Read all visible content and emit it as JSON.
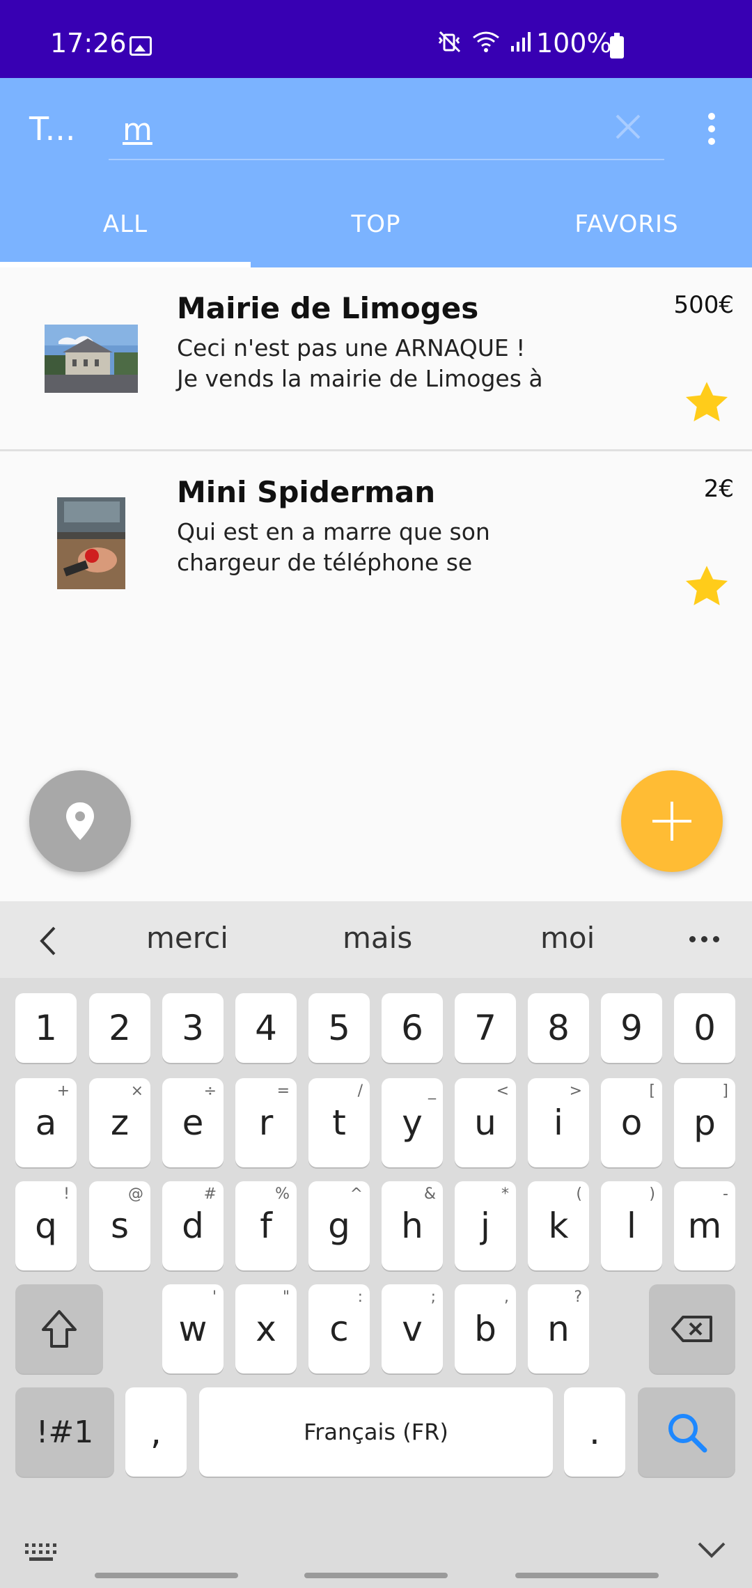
{
  "status_bar": {
    "time": "17:26",
    "battery": "100%"
  },
  "app_bar": {
    "title": "T...",
    "search_value": "m",
    "search_placeholder": ""
  },
  "tabs": [
    {
      "label": "ALL",
      "active": true
    },
    {
      "label": "TOP",
      "active": false
    },
    {
      "label": "FAVORIS",
      "active": false
    }
  ],
  "listings": [
    {
      "title": "Mairie de Limoges",
      "description_line1": "Ceci n'est pas une ARNAQUE !",
      "description_line2": "Je vends la mairie de Limoges à",
      "price": "500€",
      "favorite": true
    },
    {
      "title": "Mini Spiderman",
      "description_line1": "Qui est en a marre que son",
      "description_line2": "chargeur de téléphone se",
      "price": "2€",
      "favorite": true
    }
  ],
  "keyboard": {
    "suggestions": [
      "merci",
      "mais",
      "moi"
    ],
    "row_numbers": [
      "1",
      "2",
      "3",
      "4",
      "5",
      "6",
      "7",
      "8",
      "9",
      "0"
    ],
    "row1": [
      {
        "k": "a",
        "h": "+"
      },
      {
        "k": "z",
        "h": "×"
      },
      {
        "k": "e",
        "h": "÷"
      },
      {
        "k": "r",
        "h": "="
      },
      {
        "k": "t",
        "h": "/"
      },
      {
        "k": "y",
        "h": "_"
      },
      {
        "k": "u",
        "h": "<"
      },
      {
        "k": "i",
        "h": ">"
      },
      {
        "k": "o",
        "h": "["
      },
      {
        "k": "p",
        "h": "]"
      }
    ],
    "row2": [
      {
        "k": "q",
        "h": "!"
      },
      {
        "k": "s",
        "h": "@"
      },
      {
        "k": "d",
        "h": "#"
      },
      {
        "k": "f",
        "h": "%"
      },
      {
        "k": "g",
        "h": "^"
      },
      {
        "k": "h",
        "h": "&"
      },
      {
        "k": "j",
        "h": "*"
      },
      {
        "k": "k",
        "h": "("
      },
      {
        "k": "l",
        "h": ")"
      },
      {
        "k": "m",
        "h": "-"
      }
    ],
    "row3": [
      {
        "k": "w",
        "h": "'"
      },
      {
        "k": "x",
        "h": "\""
      },
      {
        "k": "c",
        "h": ":"
      },
      {
        "k": "v",
        "h": ";"
      },
      {
        "k": "b",
        "h": ","
      },
      {
        "k": "n",
        "h": "?"
      }
    ],
    "symbols_key": "!#1",
    "comma_key": ",",
    "space_label": "Français (FR)",
    "period_key": "."
  },
  "colors": {
    "status_bar": "#3800b3",
    "app_bar": "#7bb3ff",
    "fab_add": "#ffbc34",
    "fab_location": "#a8a8a8",
    "star": "#ffcc1a",
    "search_key_icon": "#1e88ff"
  },
  "icons": {
    "status_image": "image-icon",
    "clear": "close-icon",
    "menu": "more-vert-icon",
    "favorite": "star-icon",
    "location": "location-pin-icon",
    "add": "plus-icon",
    "shift": "shift-icon",
    "backspace": "backspace-icon",
    "search": "search-icon"
  }
}
